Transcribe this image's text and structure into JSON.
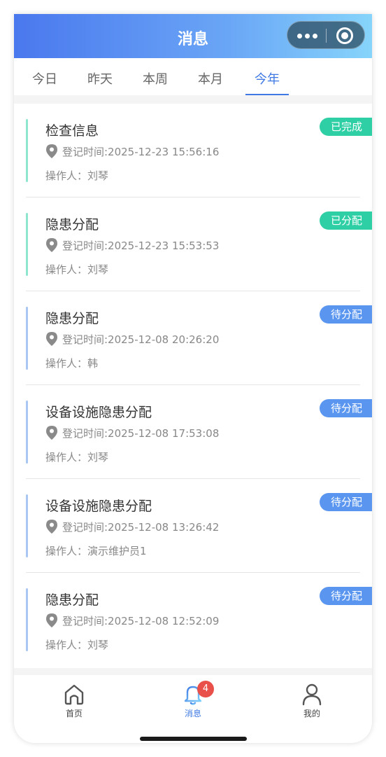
{
  "header": {
    "title": "消息"
  },
  "tabs": [
    {
      "label": "今日"
    },
    {
      "label": "昨天"
    },
    {
      "label": "本周"
    },
    {
      "label": "本月"
    },
    {
      "label": "今年",
      "active": true
    }
  ],
  "messages": [
    {
      "title": "检查信息",
      "time": "登记时间:2025-12-23 15:56:16",
      "operator": "操作人：刘琴",
      "status": "已完成",
      "status_color": "#2ecfa5",
      "bar_color": "#8ee6cf"
    },
    {
      "title": "隐患分配",
      "time": "登记时间:2025-12-23 15:53:53",
      "operator": "操作人：刘琴",
      "status": "已分配",
      "status_color": "#2ecfa5",
      "bar_color": "#8ee6cf"
    },
    {
      "title": "隐患分配",
      "time": "登记时间:2025-12-08 20:26:20",
      "operator": "操作人：韩",
      "status": "待分配",
      "status_color": "#5a96f0",
      "bar_color": "#a9c7f2"
    },
    {
      "title": "设备设施隐患分配",
      "time": "登记时间:2025-12-08 17:53:08",
      "operator": "操作人：刘琴",
      "status": "待分配",
      "status_color": "#5a96f0",
      "bar_color": "#a9c7f2"
    },
    {
      "title": "设备设施隐患分配",
      "time": "登记时间:2025-12-08 13:26:42",
      "operator": "操作人：演示维护员1",
      "status": "待分配",
      "status_color": "#5a96f0",
      "bar_color": "#a9c7f2"
    },
    {
      "title": "隐患分配",
      "time": "登记时间:2025-12-08 12:52:09",
      "operator": "操作人：刘琴",
      "status": "待分配",
      "status_color": "#5a96f0",
      "bar_color": "#a9c7f2"
    }
  ],
  "tabbar": {
    "home": {
      "label": "首页",
      "icon": "home-icon"
    },
    "messages": {
      "label": "消息",
      "icon": "bell-icon",
      "badge": "4"
    },
    "mine": {
      "label": "我的",
      "icon": "user-icon"
    }
  },
  "colors": {
    "accent": "#3f79e3",
    "badge_red": "#e9504a"
  }
}
